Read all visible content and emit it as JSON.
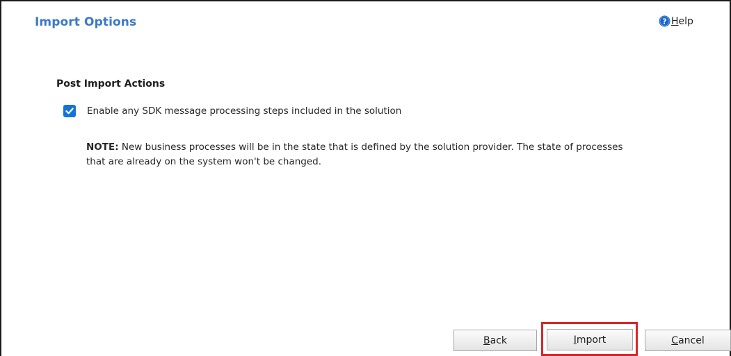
{
  "header": {
    "title": "Import Options",
    "help": {
      "icon": "question-circle-icon",
      "mnemonic": "H",
      "rest": "elp"
    }
  },
  "post_import": {
    "section_title": "Post Import Actions",
    "checkbox": {
      "checked": true,
      "label": "Enable any SDK message processing steps included in the solution"
    },
    "note": {
      "prefix": "NOTE:",
      "text": " New business processes will be in the state that is defined by the solution provider. The state of processes that are already on the system won't be changed."
    }
  },
  "footer": {
    "back": {
      "mnemonic": "B",
      "rest": "ack"
    },
    "import": {
      "mnemonic": "I",
      "rest": "mport"
    },
    "cancel": {
      "mnemonic": "C",
      "rest": "ancel"
    }
  },
  "colors": {
    "title": "#3c78c8",
    "checkbox": "#1673d6",
    "highlight": "#d9262b",
    "help_icon": "#1a64c4"
  }
}
